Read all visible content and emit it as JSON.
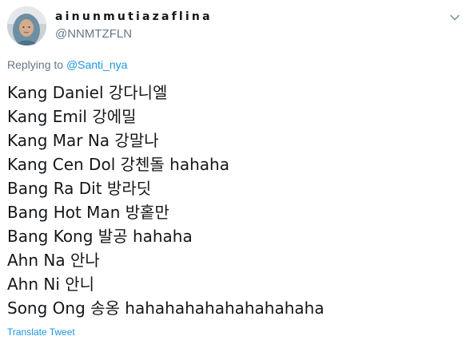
{
  "tweet": {
    "author": {
      "display_name": "ainunmutiazaflina",
      "handle": "@NNMTZFLN",
      "avatar_icon": "profile-photo-avatar"
    },
    "menu_icon": "chevron-down-icon",
    "reply_context": {
      "prefix": "Replying to ",
      "mention": "@Santi_nya"
    },
    "lines": [
      "Kang Daniel 강다니엘",
      "Kang Emil 강에밀",
      "Kang Mar Na 강말나",
      "Kang Cen Dol 강첸돌 hahaha",
      "Bang Ra Dit 방라딧",
      "Bang Hot Man 방홑만",
      "Bang Kong 발공 hahaha",
      "Ahn Na 안나",
      "Ahn Ni 안니",
      "Song Ong 송옹 hahahahahahahahahaha"
    ],
    "translate_label": "Translate Tweet"
  },
  "colors": {
    "text_primary": "#14171a",
    "text_secondary": "#657786",
    "link": "#1b95e0",
    "background": "#ffffff"
  }
}
